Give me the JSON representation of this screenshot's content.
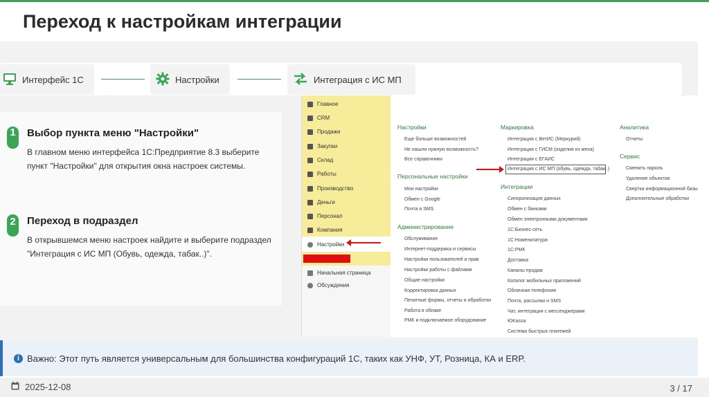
{
  "title": "Переход к настройкам интеграции",
  "steps": [
    {
      "label": "Интерфейс 1С",
      "icon": "monitor-icon"
    },
    {
      "label": "Настройки",
      "icon": "gear-icon"
    },
    {
      "label": "Интеграция с ИС МП",
      "icon": "swap-arrows-icon"
    }
  ],
  "items": [
    {
      "num": "1",
      "title": "Выбор пункта меню \"Настройки\"",
      "desc": "В главном меню интерфейса 1С:Предприятие 8.3 выберите пункт \"Настройки\" для открытия окна настроек системы."
    },
    {
      "num": "2",
      "title": "Переход в подраздел",
      "desc": "В открывшемся меню настроек найдите и выберите подраздел \"Интеграция с ИС МП (Обувь, одежда, табак..)\"."
    }
  ],
  "sidebar": [
    "Главное",
    "CRM",
    "Продажи",
    "Закупки",
    "Склад",
    "Работы",
    "Производство",
    "Деньги",
    "Персонал",
    "Компания",
    "Настройки"
  ],
  "sidebar_bottom": [
    "Начальная страница",
    "Обсуждения"
  ],
  "columns": {
    "settings": {
      "head": "Настройки",
      "items": [
        "Еще больше возможностей",
        "Не нашли нужную возможность?",
        "Все справочники"
      ]
    },
    "personal": {
      "head": "Персональные настройки",
      "items": [
        "Мои настройки",
        "Обмен с Google",
        "Почта и SMS"
      ]
    },
    "admin": {
      "head": "Администрирование",
      "items": [
        "Обслуживание",
        "Интернет-поддержка и сервисы",
        "Настройки пользователей и прав",
        "Настройки работы с файлами",
        "Общие настройки",
        "Корректировка данных",
        "Печатные формы, отчеты и обработки",
        "Работа в облаке",
        "РМК и подключаемое оборудование"
      ]
    },
    "marking": {
      "head": "Маркировка",
      "items": [
        "Интеграция с ВетИС (Меркурий)",
        "Интеграция с ГИСМ (изделия из меха)",
        "Интеграция с ЕГАИС",
        "Интеграция с ИС МП (обувь, одежда, табак..)"
      ]
    },
    "integrations": {
      "head": "Интеграции",
      "items": [
        "Синхронизация данных",
        "Обмен с банками",
        "Обмен электронными документами",
        "1С:Бизнес-сеть",
        "1С:Номенклатура",
        "1С:РМК",
        "Доставка",
        "Каналы продаж",
        "Каталог мобильных приложений",
        "Облачная телефония",
        "Почта, рассылки и SMS",
        "Чат, интеграция с мессенджерами",
        "ЮKassa",
        "Система быстрых платежей"
      ]
    },
    "analytics": {
      "head": "Аналитика",
      "items": [
        "Отчеты"
      ]
    },
    "service": {
      "head": "Сервис",
      "items": [
        "Сменить пароль",
        "Удаление объектов",
        "Свертка информационной базы",
        "Дополнительные обработки"
      ]
    }
  },
  "note": "Важно: Этот путь является универсальным для большинства конфигураций 1С, таких как УНФ, УТ, Розница, КА и ERP.",
  "footer": {
    "date": "2025-12-08",
    "page": "3 / 17"
  },
  "colors": {
    "accent": "#3aa655",
    "info": "#2f6fb5",
    "highlight_red": "#e01010"
  }
}
